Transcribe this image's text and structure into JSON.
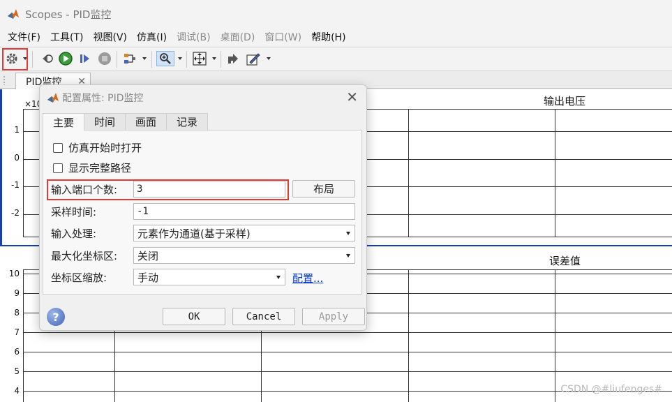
{
  "window": {
    "title": "Scopes - PID监控"
  },
  "menu": [
    {
      "label": "文件(F)",
      "enabled": true
    },
    {
      "label": "工具(T)",
      "enabled": true
    },
    {
      "label": "视图(V)",
      "enabled": true
    },
    {
      "label": "仿真(I)",
      "enabled": true
    },
    {
      "label": "调试(B)",
      "enabled": false
    },
    {
      "label": "桌面(D)",
      "enabled": false
    },
    {
      "label": "窗口(W)",
      "enabled": false
    },
    {
      "label": "帮助(H)",
      "enabled": true
    }
  ],
  "toolbar": {
    "icons": [
      "gear-icon",
      "step-back-icon",
      "run-icon",
      "step-forward-icon",
      "stop-icon",
      "signal-selector-icon",
      "zoom-in-icon",
      "autoscale-icon",
      "highlight-block-icon",
      "style-icon"
    ]
  },
  "doc_tab": {
    "label": "PID监控",
    "close": "✕"
  },
  "plots": [
    {
      "title": "输出电压",
      "exponent_label": "×10",
      "yticks": [
        "1",
        "0",
        "-1",
        "-2"
      ]
    },
    {
      "title": "误差值",
      "yticks": [
        "10",
        "9",
        "8",
        "7",
        "6",
        "5",
        "4"
      ]
    }
  ],
  "dialog": {
    "title": "配置属性: PID监控",
    "close": "✕",
    "tabs": [
      "主要",
      "时间",
      "画面",
      "记录"
    ],
    "active_tab": "主要",
    "checkboxes": [
      {
        "label": "仿真开始时打开",
        "checked": false
      },
      {
        "label": "显示完整路径",
        "checked": false
      }
    ],
    "fields": {
      "input_ports": {
        "label": "输入端口个数:",
        "value": "3",
        "button": "布局"
      },
      "sample_time": {
        "label": "采样时间:",
        "value": "-1"
      },
      "input_processing": {
        "label": "输入处理:",
        "value": "元素作为通道(基于采样)"
      },
      "maximize_axes": {
        "label": "最大化坐标区:",
        "value": "关闭"
      },
      "axes_scaling": {
        "label": "坐标区缩放:",
        "value": "手动",
        "link": "配置..."
      }
    },
    "buttons": {
      "ok": "OK",
      "cancel": "Cancel",
      "apply": "Apply"
    },
    "help": "?"
  },
  "watermark": "CSDN @#liufenges#",
  "colors": {
    "highlight": "#e53935",
    "link": "#0033cc",
    "plot_frame": "#1a3fa8"
  }
}
